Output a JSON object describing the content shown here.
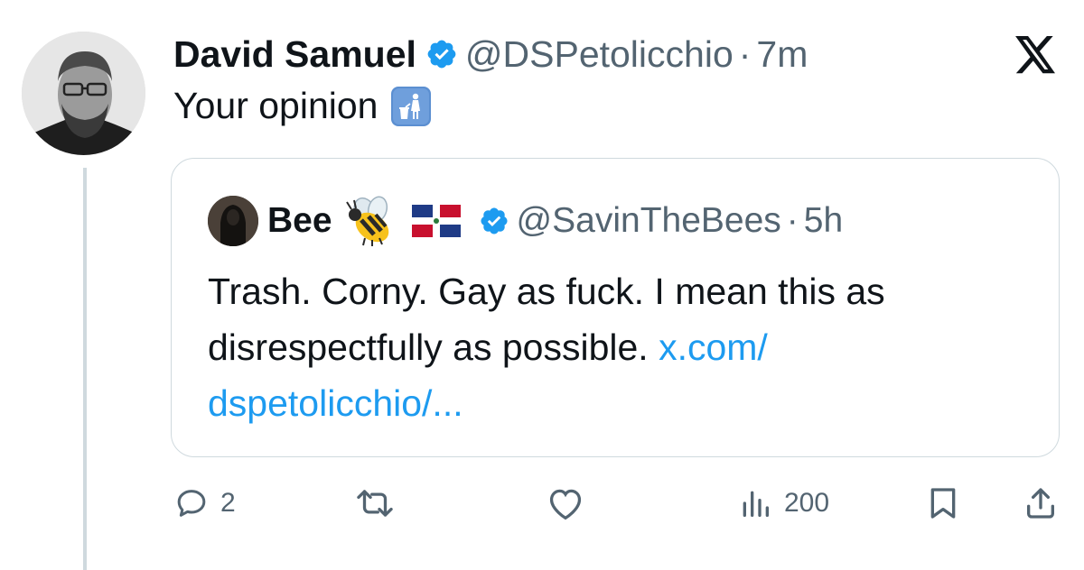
{
  "tweet": {
    "author_name": "David Samuel",
    "handle": "@DSPetolicchio",
    "separator": "·",
    "time": "7m",
    "text": "Your opinion",
    "trailing_emoji": "put-litter-in-its-place-icon"
  },
  "quote": {
    "author_name": "Bee",
    "emojis": [
      "honeybee-icon",
      "dominican-republic-flag-icon"
    ],
    "handle": "@SavinTheBees",
    "separator": "·",
    "time": "5h",
    "text": "Trash. Corny. Gay as fuck. I mean this as disrespectfully as possible. ",
    "link": "x.com/\ndspetolicchio/..."
  },
  "actions": {
    "replies": "2",
    "retweets": "",
    "likes": "",
    "views": "200"
  },
  "colors": {
    "verified": "#1d9bf0",
    "link": "#1d9bf0",
    "secondary_text": "#536471",
    "border": "#cfd9de"
  }
}
